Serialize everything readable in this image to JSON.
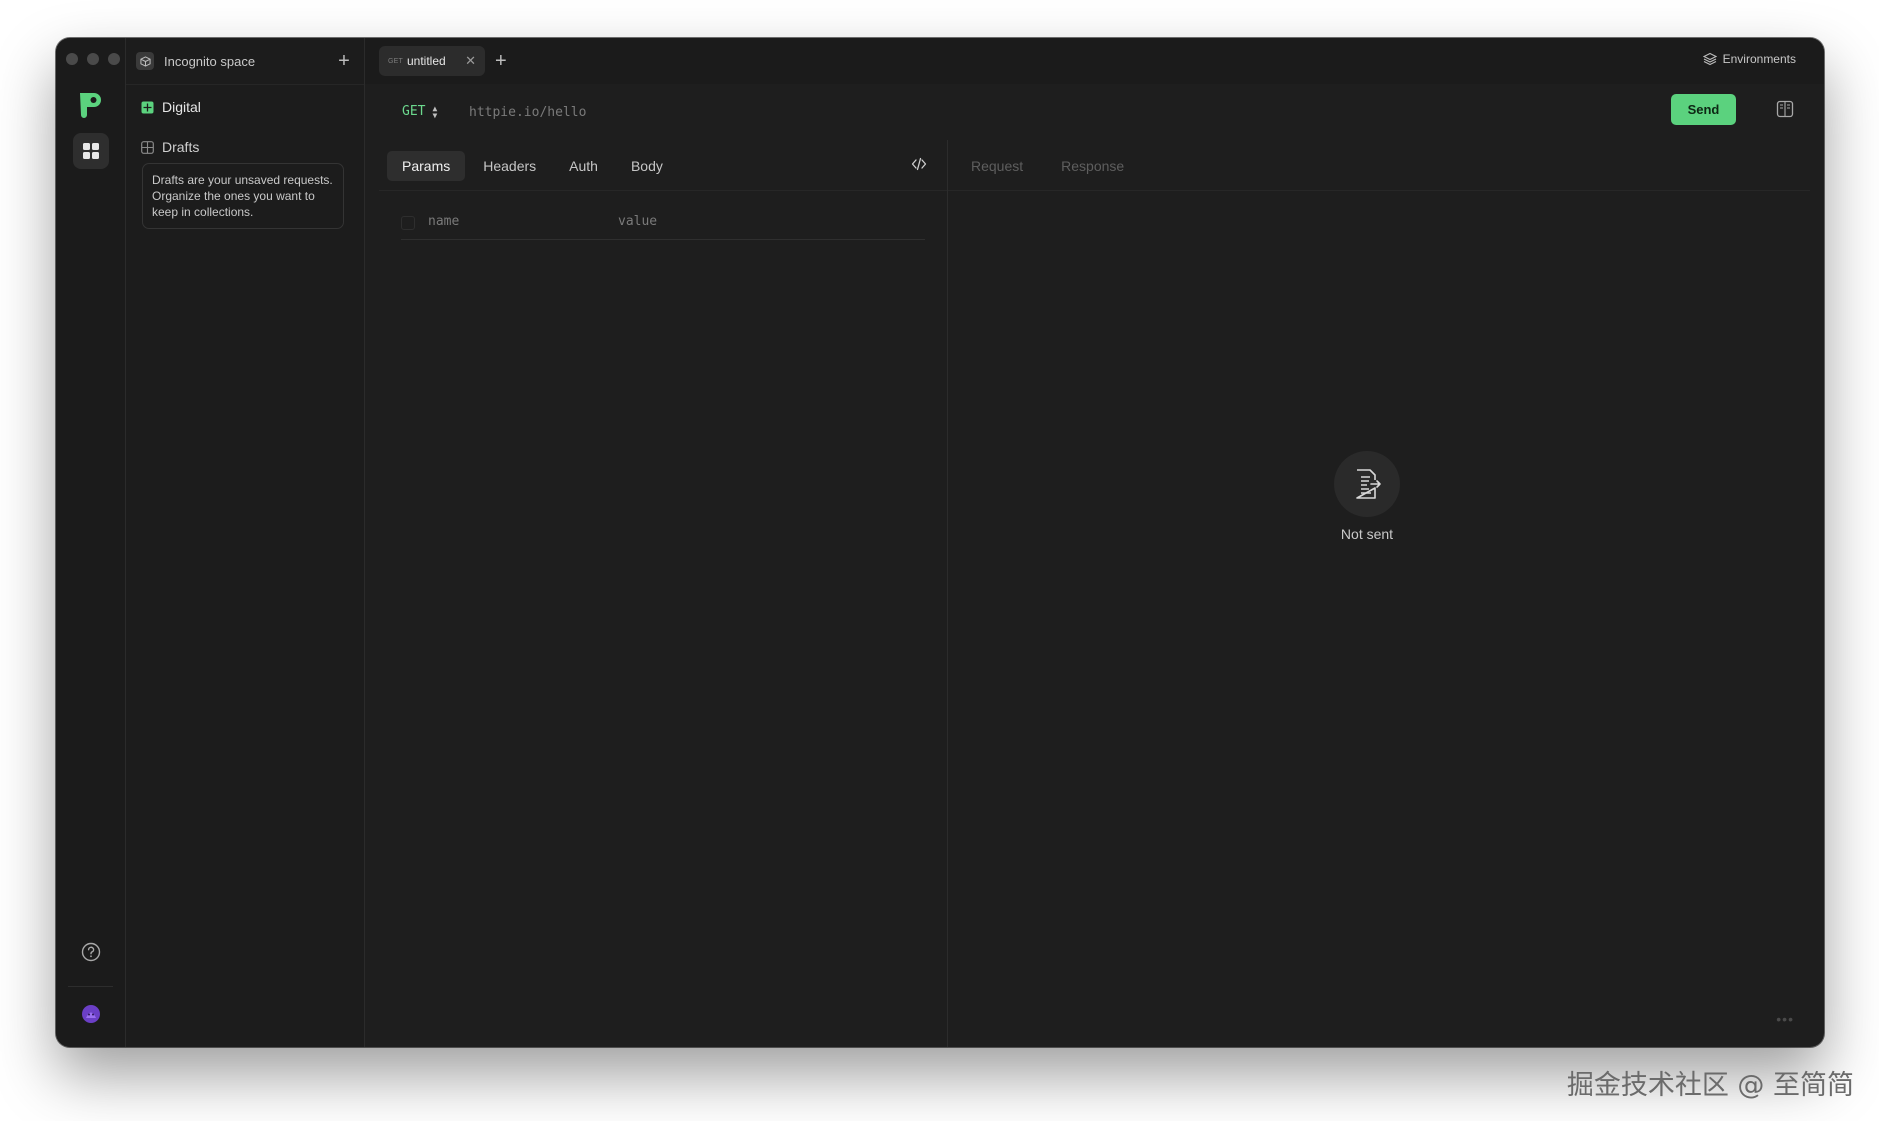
{
  "space": {
    "name": "Incognito space"
  },
  "sidebar": {
    "items": [
      {
        "label": "Digital"
      },
      {
        "label": "Drafts"
      }
    ],
    "drafts_tip": "Drafts are your unsaved requests. Organize the ones you want to keep in collections."
  },
  "tabs": [
    {
      "method": "GET",
      "title": "untitled"
    }
  ],
  "header": {
    "environments_label": "Environments"
  },
  "request": {
    "method": "GET",
    "url_placeholder": "httpie.io/hello",
    "send_label": "Send",
    "tabs": [
      "Params",
      "Headers",
      "Auth",
      "Body"
    ],
    "params": {
      "name_placeholder": "name",
      "value_placeholder": "value"
    }
  },
  "response": {
    "tabs": [
      "Request",
      "Response"
    ],
    "empty_label": "Not sent"
  },
  "watermark": "掘金技术社区 @ 至简简",
  "colors": {
    "accent": "#5bd27e",
    "background": "#1e1e1e",
    "sidebar": "#1c1c1c"
  },
  "icons": {
    "app_logo": "httpie-logo-icon",
    "apps": "apps-grid-icon",
    "help": "help-circle-icon",
    "avatar": "user-avatar-icon",
    "environments": "layers-icon",
    "code": "code-icon",
    "not_sent": "document-send-icon",
    "panel": "panel-layout-icon"
  }
}
